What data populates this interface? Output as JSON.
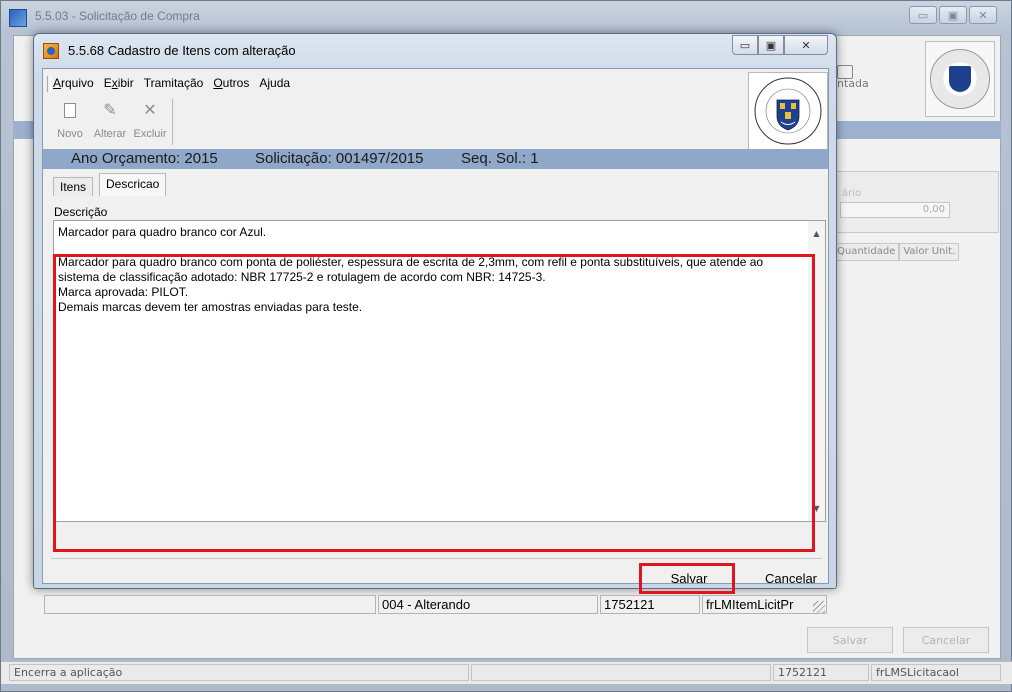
{
  "background_window": {
    "title": "5.5.03 - Solicitação de Compra",
    "toolbar_partial_label": "ntada",
    "group_label": "ário",
    "group_value": "0,00",
    "grid_headers": [
      "Quantidade",
      "Valor Unit."
    ],
    "buttons": {
      "save": "Salvar",
      "cancel": "Cancelar"
    },
    "status": {
      "message": "Encerra a aplicação",
      "code": "1752121",
      "form": "frLMSLicitacaol"
    }
  },
  "dialog": {
    "title": "5.5.68 Cadastro de Itens com alteração",
    "menu": [
      {
        "pre": "",
        "key": "A",
        "post": "rquivo"
      },
      {
        "pre": "E",
        "key": "x",
        "post": "ibir"
      },
      {
        "pre": "",
        "key": "",
        "post": "Tramitação"
      },
      {
        "pre": "",
        "key": "O",
        "post": "utros"
      },
      {
        "pre": "A",
        "key": "j",
        "post": "uda"
      }
    ],
    "toolbar": {
      "novo": "Novo",
      "alterar": "Alterar",
      "excluir": "Excluir"
    },
    "logo": {
      "top_text": "Federal de",
      "left_text": "Universidade",
      "right_text": "Santa Maria",
      "year": "1960"
    },
    "info": {
      "ano": "Ano Orçamento: 2015",
      "solicitacao": "Solicitação: 001497/2015",
      "seq": "Seq. Sol.: 1"
    },
    "tabs": [
      {
        "label": "Itens",
        "active": false
      },
      {
        "label": "Descricao",
        "active": true
      }
    ],
    "description_label": "Descrição",
    "description_text": "Marcador para quadro branco cor Azul.\n\nMarcador para quadro branco com ponta de poliéster, espessura de escrita de 2,3mm, com refil e ponta substituíveis, que atende ao sistema de classificação adotado: NBR 17725-2 e rotulagem de acordo com NBR: 14725-3.\nMarca aprovada: PILOT.\nDemais marcas devem ter amostras enviadas para teste.",
    "buttons": {
      "save": "Salvar",
      "cancel": "Cancelar"
    },
    "status": {
      "mode": "004 - Alterando",
      "code": "1752121",
      "form": "frLMItemLicitPr"
    },
    "highlight_color": "#e0141e"
  }
}
